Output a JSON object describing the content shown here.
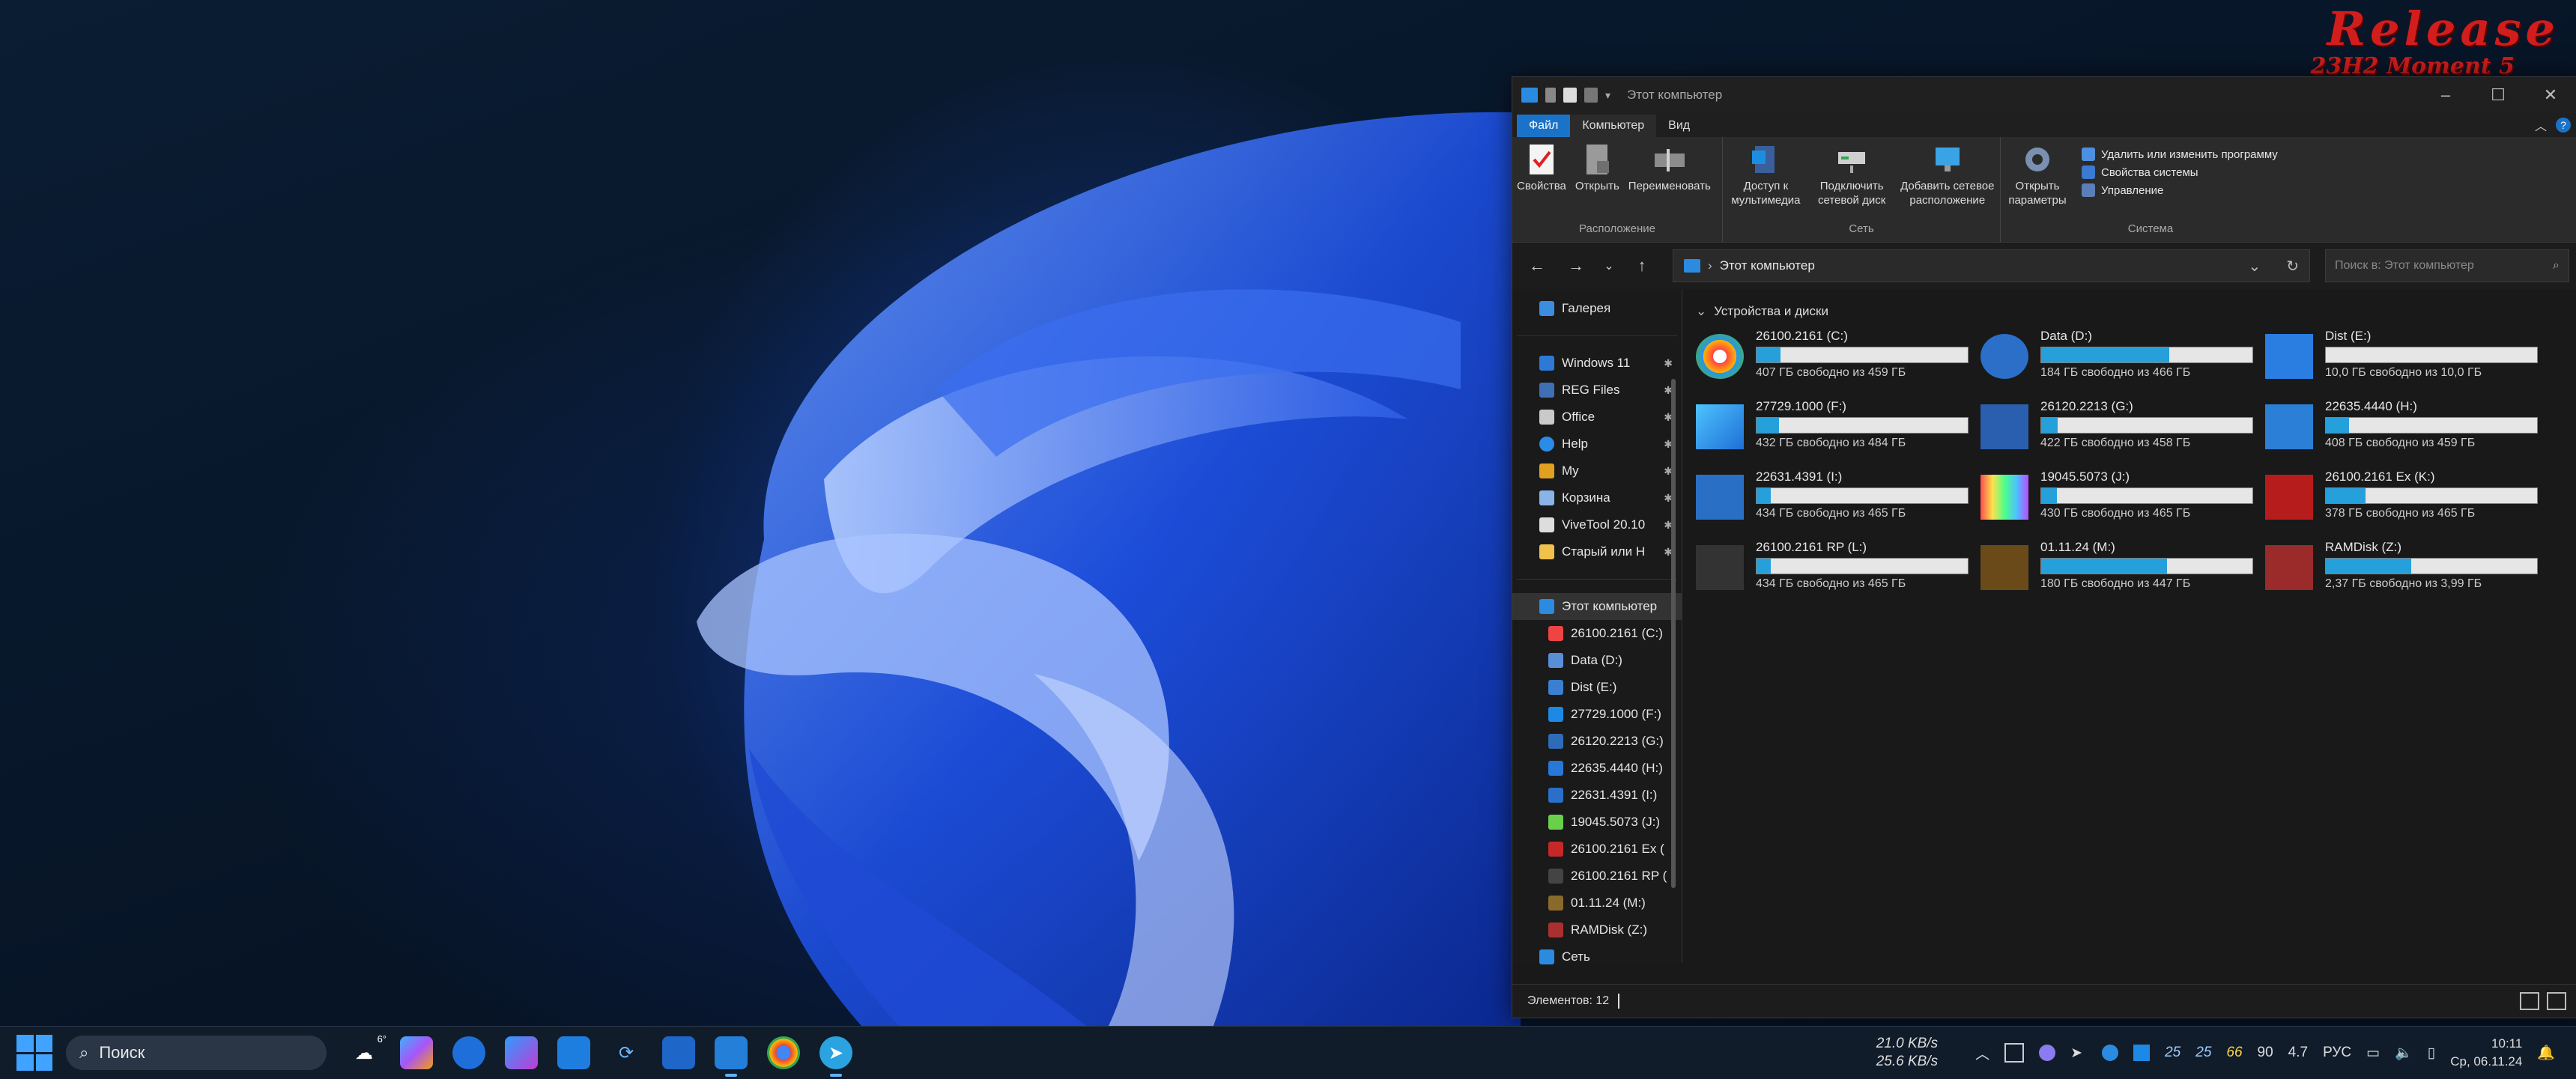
{
  "desktop": {
    "release_title": "Release",
    "release_subtitle": "23H2 Moment 5"
  },
  "explorer": {
    "title": "Этот компьютер",
    "tabs": [
      "Файл",
      "Компьютер",
      "Вид"
    ],
    "ribbon": {
      "location_group": "Расположение",
      "network_group": "Сеть",
      "system_group": "Система",
      "properties": "Свойства",
      "open": "Открыть",
      "rename": "Переименовать",
      "media_access": "Доступ к мультимедиа",
      "map_drive": "Подключить сетевой диск",
      "add_network_location": "Добавить сетевое расположение",
      "open_settings": "Открыть параметры",
      "uninstall": "Удалить или изменить программу",
      "system_properties": "Свойства системы",
      "manage": "Управление"
    },
    "address": "Этот компьютер",
    "search_placeholder": "Поиск в: Этот компьютер",
    "nav": {
      "gallery": "Галерея",
      "pinned": [
        "Windows 11",
        "REG Files",
        "Office",
        "Help",
        "My",
        "Корзина",
        "ViveTool 20.10",
        "Старый или Н"
      ],
      "this_pc": "Этот компьютер",
      "drives": [
        "26100.2161 (C:)",
        "Data (D:)",
        "Dist (E:)",
        "27729.1000 (F:)",
        "26120.2213 (G:)",
        "22635.4440 (H:)",
        "22631.4391 (I:)",
        "19045.5073 (J:)",
        "26100.2161 Ex (",
        "26100.2161 RP (",
        "01.11.24 (M:)",
        "RAMDisk (Z:)"
      ],
      "network": "Сеть"
    },
    "section_title": "Устройства и диски",
    "drives": [
      {
        "name": "26100.2161 (C:)",
        "free": "407 ГБ свободно из 459 ГБ",
        "used": 0.113
      },
      {
        "name": "Data (D:)",
        "free": "184 ГБ свободно из 466 ГБ",
        "used": 0.605
      },
      {
        "name": "Dist (E:)",
        "free": "10,0 ГБ свободно из 10,0 ГБ",
        "used": 0.0
      },
      {
        "name": "27729.1000 (F:)",
        "free": "432 ГБ свободно из 484 ГБ",
        "used": 0.107
      },
      {
        "name": "26120.2213 (G:)",
        "free": "422 ГБ свободно из 458 ГБ",
        "used": 0.079
      },
      {
        "name": "22635.4440 (H:)",
        "free": "408 ГБ свободно из 459 ГБ",
        "used": 0.111
      },
      {
        "name": "22631.4391 (I:)",
        "free": "434 ГБ свободно из 465 ГБ",
        "used": 0.067
      },
      {
        "name": "19045.5073 (J:)",
        "free": "430 ГБ свободно из 465 ГБ",
        "used": 0.075
      },
      {
        "name": "26100.2161 Ex (K:)",
        "free": "378 ГБ свободно из 465 ГБ",
        "used": 0.187
      },
      {
        "name": "26100.2161 RP (L:)",
        "free": "434 ГБ свободно из 465 ГБ",
        "used": 0.067
      },
      {
        "name": "01.11.24 (M:)",
        "free": "180 ГБ свободно из 447 ГБ",
        "used": 0.597
      },
      {
        "name": "RAMDisk (Z:)",
        "free": "2,37 ГБ свободно из 3,99 ГБ",
        "used": 0.406
      }
    ],
    "status": "Элементов: 12"
  },
  "taskbar": {
    "search_placeholder": "Поиск",
    "weather_temp": "6°",
    "net_down": "21.0 KB/s",
    "net_up": "25.6 KB/s",
    "tray_values": [
      "25",
      "25",
      "66",
      "90",
      "4.7"
    ],
    "language": "РУС",
    "time": "10:11",
    "date": "Ср, 06.11.24"
  }
}
